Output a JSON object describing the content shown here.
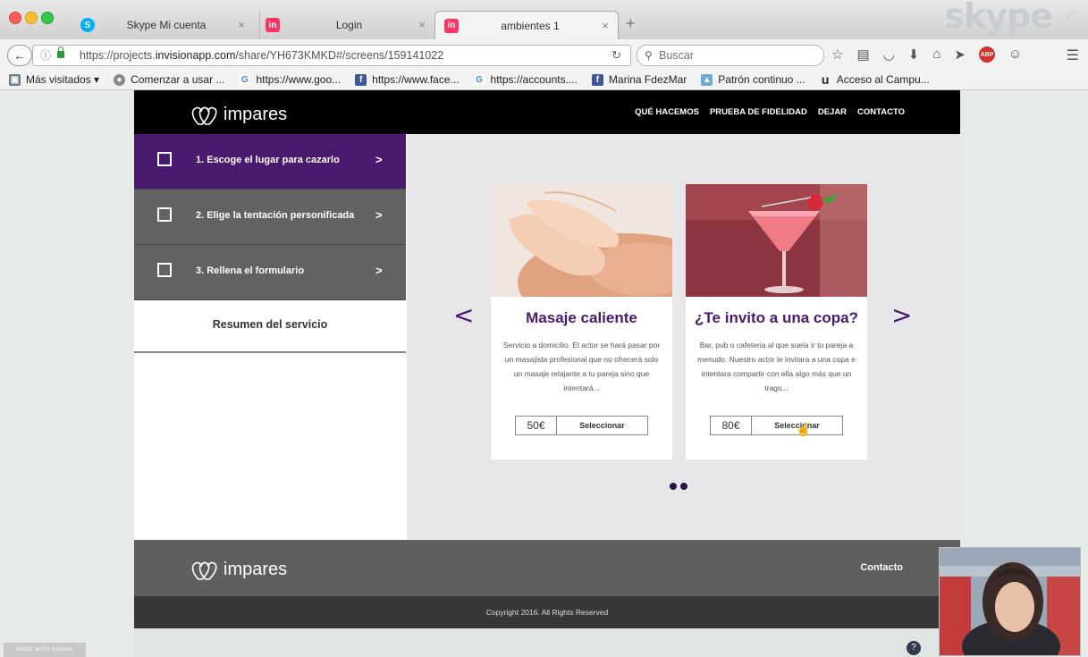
{
  "browser": {
    "tabs": [
      {
        "title": "Skype Mi cuenta",
        "favicon": "skype-icon",
        "active": false
      },
      {
        "title": "Login",
        "favicon": "invision-icon",
        "active": false
      },
      {
        "title": "ambientes 1",
        "favicon": "invision-icon",
        "active": true
      }
    ],
    "new_tab_symbol": "+",
    "close_symbol": "×",
    "url_prefix": "https://projects.",
    "url_domain": "invisionapp.com",
    "url_suffix": "/share/YH673KMKD#/screens/159141022",
    "search_placeholder": "Buscar",
    "skype_logo": "skype",
    "bookmarks": [
      {
        "label": "Más visitados",
        "icon": "most-visited-icon",
        "color": "#6b7b8c"
      },
      {
        "label": "Comenzar a usar ...",
        "icon": "globe-icon",
        "color": "#888888"
      },
      {
        "label": "https://www.goo...",
        "icon": "google-icon",
        "color": "#4285f4"
      },
      {
        "label": "https://www.face...",
        "icon": "facebook-icon",
        "color": "#3b5998"
      },
      {
        "label": "https://accounts....",
        "icon": "google-icon",
        "color": "#4285f4"
      },
      {
        "label": "Marina FdezMar",
        "icon": "facebook-icon",
        "color": "#3b5998"
      },
      {
        "label": "Patrón continuo ...",
        "icon": "image-icon",
        "color": "#6fa7d6"
      },
      {
        "label": "Acceso al Campu...",
        "icon": "university-icon",
        "color": "#222222"
      }
    ]
  },
  "site": {
    "brand": "impares",
    "nav": [
      "QUÉ HACEMOS",
      "PRUEBA DE FIDELIDAD",
      "DEJAR",
      "CONTACTO"
    ],
    "steps": [
      {
        "label": "1. Escoge el lugar para cazarlo",
        "arrow": ">"
      },
      {
        "label": "2. Elige la tentación personificada",
        "arrow": ">"
      },
      {
        "label": "3. Rellena el formulario",
        "arrow": ">"
      }
    ],
    "summary": "Resumen del servicio",
    "carousel_prev": "<",
    "carousel_next": ">",
    "cards": [
      {
        "title": "Masaje caliente",
        "description": "Servicio a domicilio. El actor se hará pasar por un masajista profesional que no ofrecerá solo un masaje relajante a tu pareja sino que intentará...",
        "price": "50€",
        "button": "Seleccionar"
      },
      {
        "title": "¿Te invito a una copa?",
        "description": "Bar, pub o cafeteria al que suela ir tu pareja a menudo. Nuestro actor le invitara a una copa e intentara compartir con ella algo más que un trago...",
        "price": "80€",
        "button": "Seleccionar"
      }
    ],
    "footer_contact": "Contacto",
    "copyright": "Copyright 2016. All Rights Reserved",
    "accent_color": "#4a1a6e"
  },
  "overlay": {
    "invision_badge": "MADE WITH  InVision",
    "help": "?"
  }
}
